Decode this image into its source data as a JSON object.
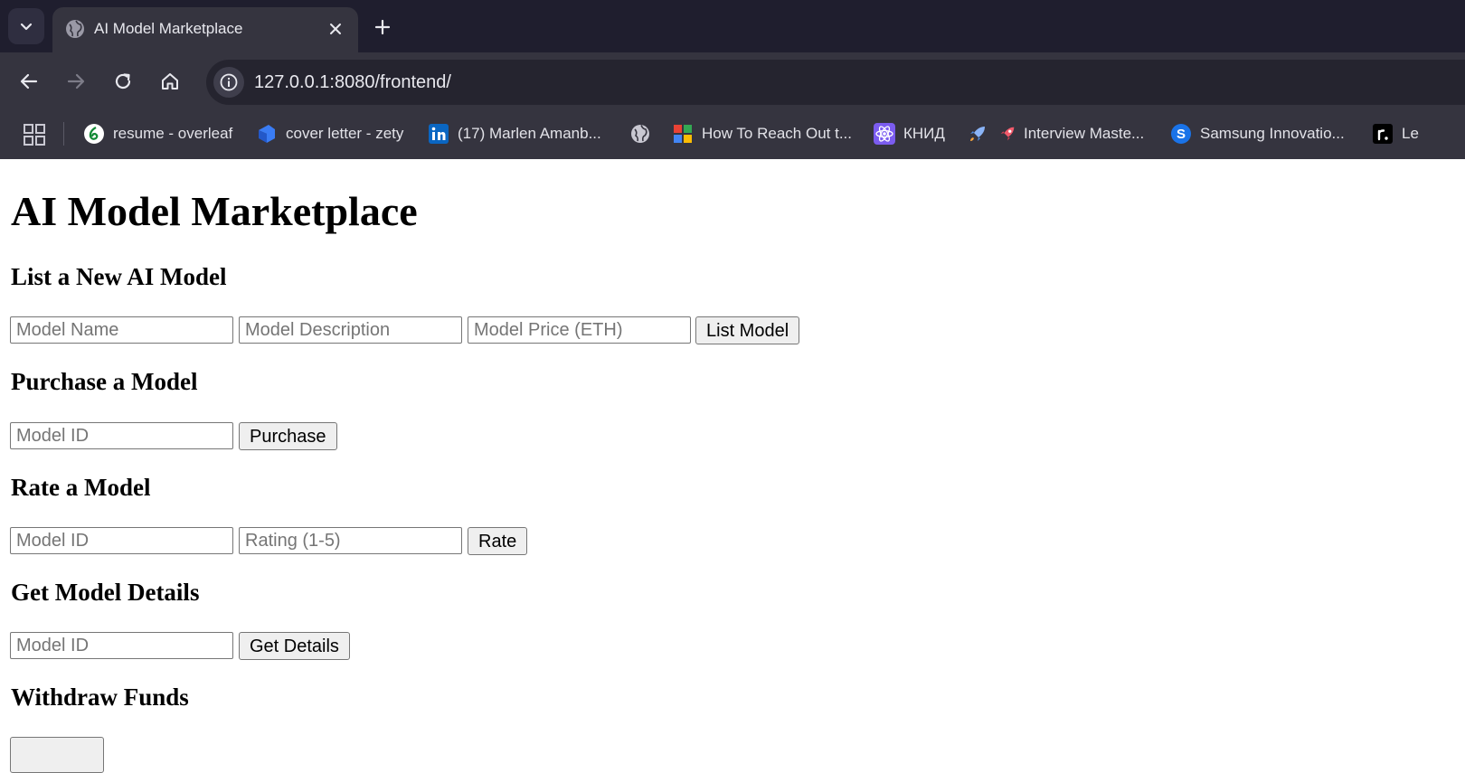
{
  "browser": {
    "tab": {
      "title": "AI Model Marketplace"
    },
    "url": "127.0.0.1:8080/frontend/",
    "bookmarks": [
      {
        "label": "resume - overleaf",
        "icon": "overleaf-icon"
      },
      {
        "label": "cover letter - zety",
        "icon": "zety-icon"
      },
      {
        "label": "(17) Marlen Amanb...",
        "icon": "linkedin-icon"
      },
      {
        "label": "",
        "icon": "globe-icon"
      },
      {
        "label": "How To Reach Out t...",
        "icon": "puzzle-icon"
      },
      {
        "label": "КНИД",
        "icon": "react-icon"
      },
      {
        "label": "Interview Maste...",
        "icon": "rocket-icon"
      },
      {
        "label": "Samsung Innovatio...",
        "icon": "samsung-s-icon"
      },
      {
        "label": "Le",
        "icon": "r-dot-icon"
      }
    ]
  },
  "page": {
    "title": "AI Model Marketplace",
    "list_section": {
      "heading": "List a New AI Model",
      "name_placeholder": "Model Name",
      "description_placeholder": "Model Description",
      "price_placeholder": "Model Price (ETH)",
      "button": "List Model"
    },
    "purchase_section": {
      "heading": "Purchase a Model",
      "id_placeholder": "Model ID",
      "button": "Purchase"
    },
    "rate_section": {
      "heading": "Rate a Model",
      "id_placeholder": "Model ID",
      "rating_placeholder": "Rating (1-5)",
      "button": "Rate"
    },
    "details_section": {
      "heading": "Get Model Details",
      "id_placeholder": "Model ID",
      "button": "Get Details"
    },
    "withdraw_section": {
      "heading": "Withdraw Funds"
    }
  },
  "colors": {
    "tabstrip": "#1f1e2e",
    "toolbar": "#35343f",
    "omnibox": "#25242f"
  }
}
